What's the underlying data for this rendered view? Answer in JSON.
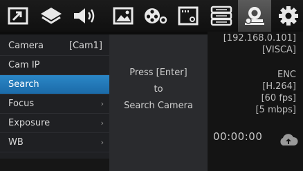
{
  "toolbar": {
    "icons": [
      "picture-in-picture-icon",
      "layers-icon",
      "speaker-icon",
      "image-icon",
      "film-reel-icon",
      "video-settings-icon",
      "network-storage-icon",
      "camera-settings-icon",
      "gear-icon"
    ],
    "active": "camera-settings-icon",
    "accent": "#2b87c7"
  },
  "menu": {
    "items": [
      {
        "label": "Camera",
        "value": "[Cam1]",
        "arrow": ""
      },
      {
        "label": "Cam IP",
        "value": "",
        "arrow": ""
      },
      {
        "label": "Search",
        "value": "",
        "arrow": ""
      },
      {
        "label": "Focus",
        "value": "",
        "arrow": "›"
      },
      {
        "label": "Exposure",
        "value": "",
        "arrow": "›"
      },
      {
        "label": "WB",
        "value": "",
        "arrow": "›"
      }
    ],
    "selected_index": 2
  },
  "dialog": {
    "line1": "Press [Enter]",
    "line2": "to",
    "line3": "Search Camera"
  },
  "info": {
    "ip": "[192.168.0.101]",
    "protocol": "[VISCA]",
    "enc_label": "ENC",
    "codec": "[H.264]",
    "fps": "[60 fps]",
    "bitrate": "[5 mbps]",
    "timecode": "00:00:00"
  }
}
